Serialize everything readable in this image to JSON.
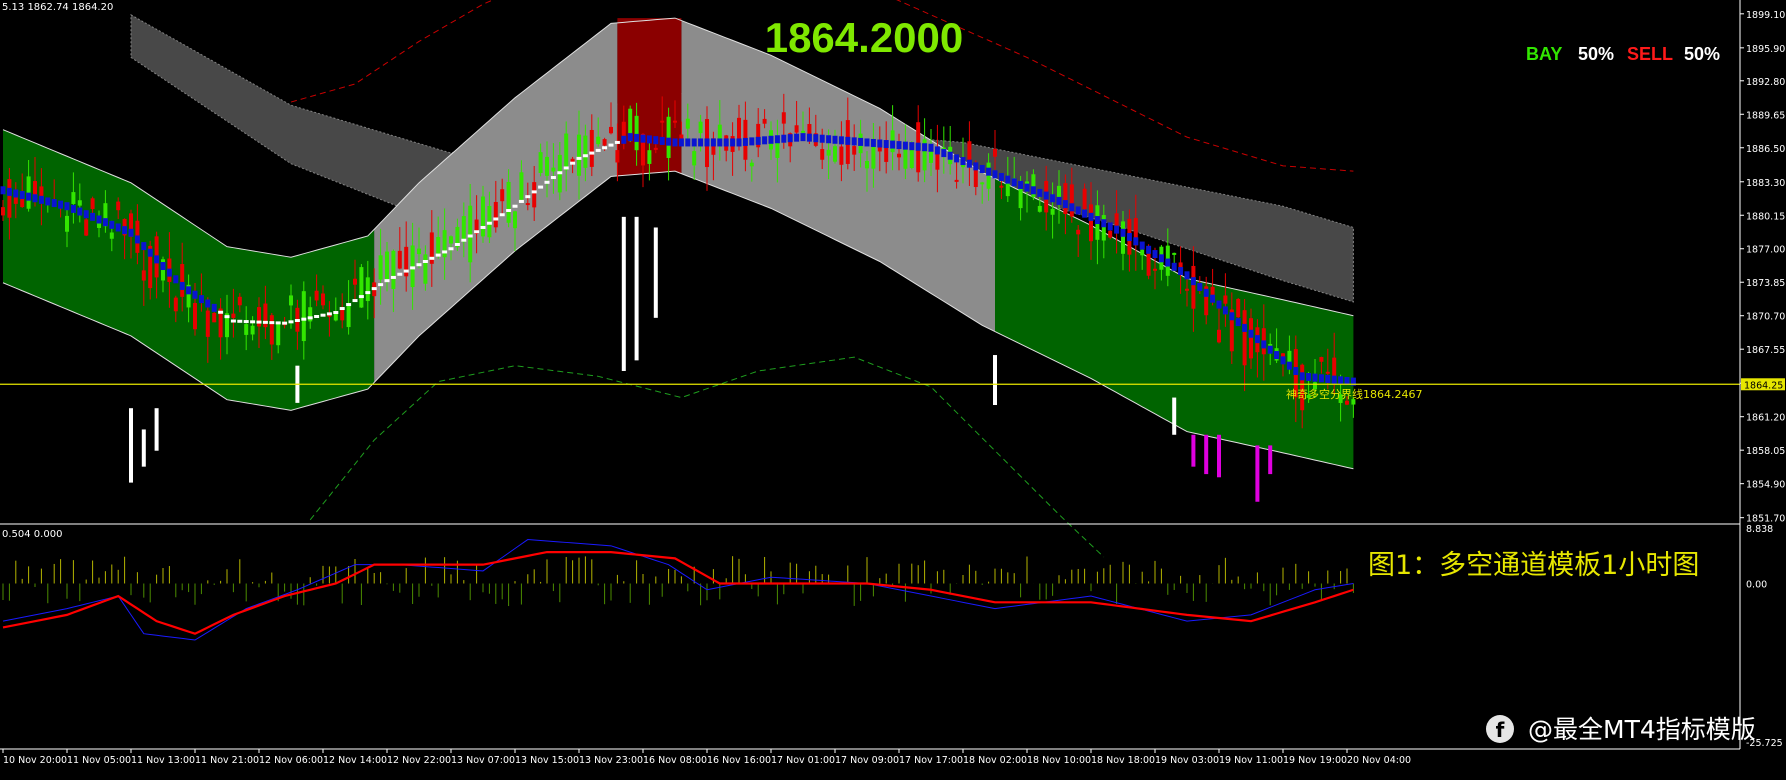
{
  "header": {
    "info": "5.13 1862.74 1864.20",
    "big_price": "1864.2000",
    "bay_label": "BAY",
    "bay_value": "50%",
    "sell_label": "SELL",
    "sell_value": "50%"
  },
  "caption": "图1：多空通道模板1小时图",
  "watermark": "@最全MT4指标模版",
  "colors": {
    "background": "#000000",
    "bull_candle": "#32e600",
    "bear_candle": "#e80000",
    "green_channel": "#006400",
    "grey_channel": "#8c8c8c",
    "red_zone": "#8b0000",
    "dark_band": "#555555",
    "blue_line": "#0a14d2",
    "white_line": "#ffffff",
    "level_line": "#e6e600",
    "spike_magenta": "#e000e0",
    "spike_white": "#ffffff",
    "big_price": "#7fe800",
    "caption": "#e6e600",
    "osc_red": "#ff0000",
    "osc_blue": "#1a1aff"
  },
  "level_line": {
    "price": 1864.25,
    "label": "神奇多空分界线1864.2467",
    "axis_tag": "1864.25"
  },
  "subwindow": {
    "info": "0.504 0.000",
    "top_value": "8.838",
    "zero_label": "0.00",
    "bottom_value": "-25.725"
  },
  "chart_data": {
    "type": "line",
    "y_axis_ticks": [
      "1899.10",
      "1895.90",
      "1892.80",
      "1889.65",
      "1886.50",
      "1883.30",
      "1880.15",
      "1877.00",
      "1873.85",
      "1870.70",
      "1867.55",
      "1864.35",
      "1861.20",
      "1858.05",
      "1854.90",
      "1851.70"
    ],
    "ylim": [
      1851.2,
      1900.4
    ],
    "x_axis_ticks": [
      "10 Nov 20:00",
      "11 Nov 05:00",
      "11 Nov 13:00",
      "11 Nov 21:00",
      "12 Nov 06:00",
      "12 Nov 14:00",
      "12 Nov 22:00",
      "13 Nov 07:00",
      "13 Nov 15:00",
      "13 Nov 23:00",
      "16 Nov 08:00",
      "16 Nov 16:00",
      "17 Nov 01:00",
      "17 Nov 09:00",
      "17 Nov 17:00",
      "18 Nov 02:00",
      "18 Nov 10:00",
      "18 Nov 18:00",
      "19 Nov 03:00",
      "19 Nov 11:00",
      "19 Nov 19:00",
      "20 Nov 04:00"
    ],
    "x_index": [
      0,
      10,
      20,
      30,
      40,
      50,
      60,
      70,
      80,
      90,
      100,
      110,
      120,
      130,
      140,
      150,
      160,
      170,
      180,
      190,
      200,
      210
    ],
    "n_bars": 212,
    "channel_mid": [
      [
        0,
        1881.0
      ],
      [
        20,
        1876.0
      ],
      [
        35,
        1870.0
      ],
      [
        45,
        1869.0
      ],
      [
        57,
        1871.0
      ],
      [
        65,
        1876.0
      ],
      [
        80,
        1884.0
      ],
      [
        95,
        1891.0
      ],
      [
        105,
        1891.5
      ],
      [
        120,
        1888.0
      ],
      [
        137,
        1883.0
      ],
      [
        153,
        1877.0
      ],
      [
        170,
        1872.0
      ],
      [
        185,
        1867.0
      ],
      [
        200,
        1865.0
      ],
      [
        211,
        1863.5
      ]
    ],
    "channel_half_width": 7.2,
    "blue_line": [
      [
        0,
        1882.5
      ],
      [
        10,
        1881.0
      ],
      [
        20,
        1878.5
      ],
      [
        28,
        1873.5
      ],
      [
        36,
        1870.2
      ],
      [
        44,
        1870.0
      ],
      [
        52,
        1871.0
      ],
      [
        60,
        1874.0
      ],
      [
        70,
        1877.0
      ],
      [
        80,
        1881.0
      ],
      [
        90,
        1885.5
      ],
      [
        98,
        1887.5
      ],
      [
        105,
        1887.0
      ],
      [
        115,
        1887.0
      ],
      [
        125,
        1887.5
      ],
      [
        135,
        1887.0
      ],
      [
        145,
        1886.5
      ],
      [
        155,
        1884.0
      ],
      [
        165,
        1881.5
      ],
      [
        175,
        1878.5
      ],
      [
        185,
        1874.5
      ],
      [
        195,
        1869.0
      ],
      [
        203,
        1865.0
      ],
      [
        211,
        1864.5
      ]
    ],
    "upper_dashed_red": [
      [
        45,
        1890.8
      ],
      [
        55,
        1892.5
      ],
      [
        65,
        1896.5
      ],
      [
        75,
        1900.0
      ],
      [
        90,
        1904.0
      ],
      [
        110,
        1906.0
      ],
      [
        130,
        1903.0
      ],
      [
        160,
        1895.0
      ],
      [
        185,
        1887.5
      ],
      [
        200,
        1884.8
      ],
      [
        211,
        1884.3
      ]
    ],
    "lower_dashed_green": [
      [
        48,
        1851.5
      ],
      [
        58,
        1859.0
      ],
      [
        68,
        1864.5
      ],
      [
        80,
        1866.0
      ],
      [
        93,
        1865.0
      ],
      [
        106,
        1863.0
      ],
      [
        118,
        1865.5
      ],
      [
        133,
        1866.8
      ],
      [
        145,
        1864.0
      ],
      [
        155,
        1858.0
      ],
      [
        165,
        1852.0
      ],
      [
        172,
        1848.0
      ]
    ],
    "grey_band": {
      "upper": [
        [
          20,
          1899.0
        ],
        [
          45,
          1890.5
        ],
        [
          70,
          1886.0
        ],
        [
          90,
          1890.0
        ],
        [
          110,
          1892.0
        ],
        [
          130,
          1888.0
        ],
        [
          150,
          1887.0
        ],
        [
          175,
          1884.0
        ],
        [
          200,
          1881.0
        ],
        [
          211,
          1879.0
        ]
      ],
      "lower": [
        [
          20,
          1895.0
        ],
        [
          45,
          1885.0
        ],
        [
          70,
          1879.0
        ],
        [
          90,
          1886.0
        ],
        [
          110,
          1887.0
        ],
        [
          130,
          1883.0
        ],
        [
          150,
          1883.5
        ],
        [
          175,
          1879.0
        ],
        [
          200,
          1874.0
        ],
        [
          211,
          1872.0
        ]
      ]
    },
    "green_zones": [
      [
        0,
        58
      ],
      [
        155,
        211
      ]
    ],
    "grey_zones": [
      [
        58,
        96
      ],
      [
        106,
        155
      ]
    ],
    "red_zone": [
      96,
      106
    ],
    "oscillator": {
      "ylim": [
        -25.725,
        8.838
      ],
      "red": [
        [
          0,
          -7
        ],
        [
          10,
          -5
        ],
        [
          18,
          -2
        ],
        [
          24,
          -6
        ],
        [
          30,
          -8
        ],
        [
          36,
          -5
        ],
        [
          44,
          -2
        ],
        [
          52,
          0
        ],
        [
          58,
          3
        ],
        [
          65,
          3
        ],
        [
          75,
          3
        ],
        [
          85,
          5
        ],
        [
          95,
          5
        ],
        [
          105,
          4
        ],
        [
          112,
          0
        ],
        [
          120,
          0
        ],
        [
          135,
          0
        ],
        [
          145,
          -1
        ],
        [
          155,
          -3
        ],
        [
          170,
          -3
        ],
        [
          185,
          -5
        ],
        [
          195,
          -6
        ],
        [
          205,
          -3
        ],
        [
          211,
          -1
        ]
      ],
      "blue": [
        [
          0,
          -6
        ],
        [
          10,
          -4
        ],
        [
          18,
          -2
        ],
        [
          22,
          -8
        ],
        [
          30,
          -9
        ],
        [
          38,
          -4
        ],
        [
          46,
          -1
        ],
        [
          55,
          3
        ],
        [
          62,
          3
        ],
        [
          75,
          2
        ],
        [
          82,
          7
        ],
        [
          95,
          6
        ],
        [
          104,
          3
        ],
        [
          110,
          -1
        ],
        [
          120,
          1
        ],
        [
          135,
          0
        ],
        [
          145,
          -2
        ],
        [
          155,
          -4
        ],
        [
          170,
          -2
        ],
        [
          185,
          -6
        ],
        [
          195,
          -5
        ],
        [
          205,
          -1
        ],
        [
          211,
          0
        ]
      ]
    }
  }
}
